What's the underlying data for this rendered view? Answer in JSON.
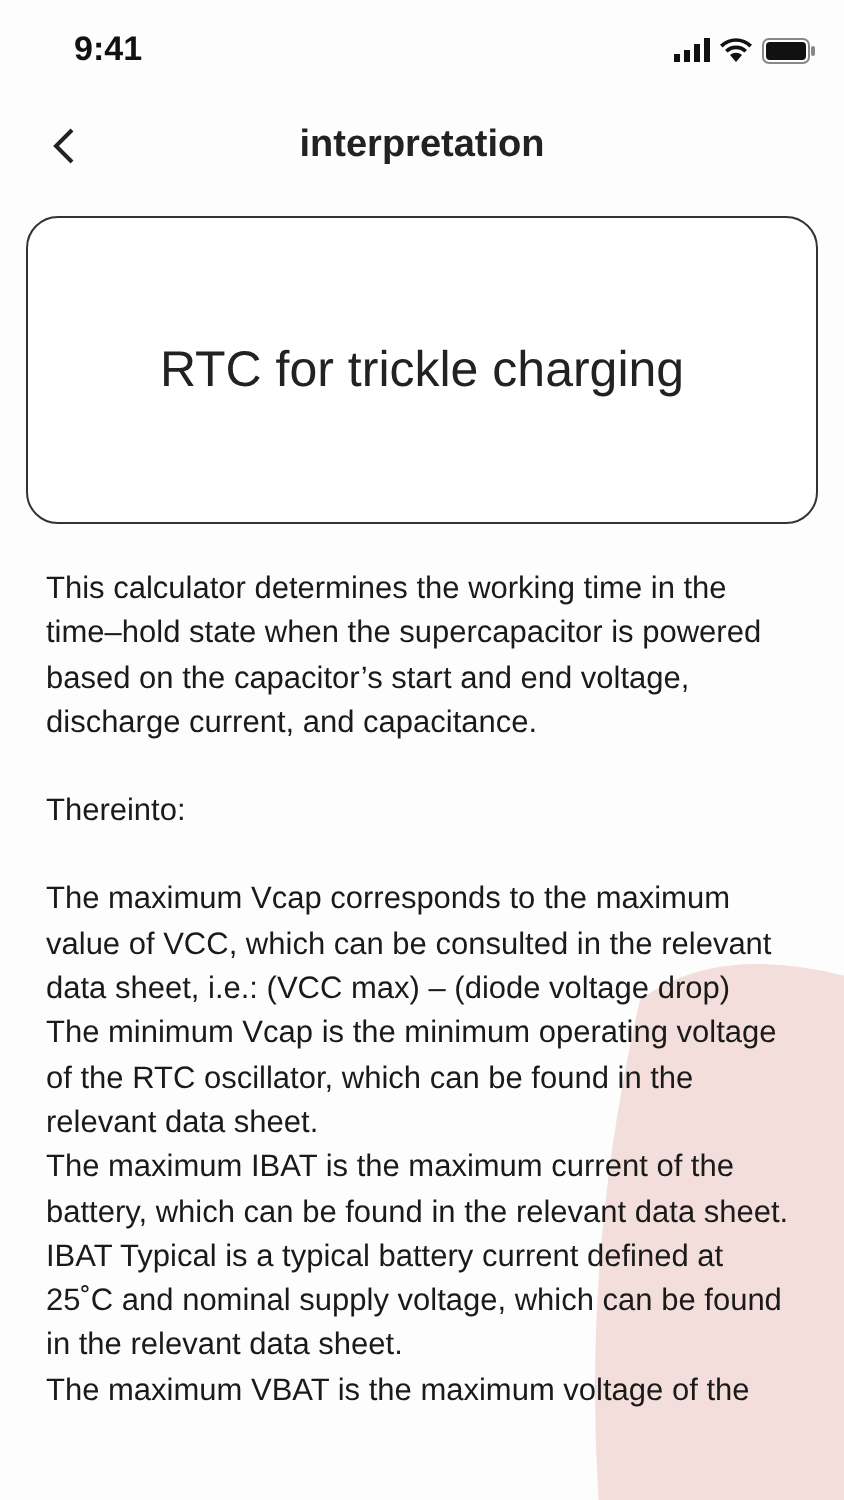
{
  "status_bar": {
    "time": "9:41"
  },
  "nav": {
    "title": "interpretation"
  },
  "card": {
    "title": "RTC for trickle charging"
  },
  "paragraphs": [
    "This calculator determines the working time in the time–hold state when the supercapacitor is powered based on the capacitor’s start and end voltage, discharge current, and capacitance.",
    "Thereinto:",
    "The maximum Vcap corresponds to the maximum value of VCC, which can be consulted in the relevant data sheet, i.e.: (VCC max) – (diode voltage drop)",
    "The minimum Vcap is the minimum operating voltage of the RTC oscillator, which can be found in the relevant data sheet.",
    "The maximum IBAT is the maximum current of the battery, which can be found in the relevant data sheet.",
    "IBAT Typical is a typical battery current defined at 25˚C and nominal supply voltage, which can be found in the relevant data sheet.",
    "The maximum VBAT is the maximum voltage of the"
  ]
}
